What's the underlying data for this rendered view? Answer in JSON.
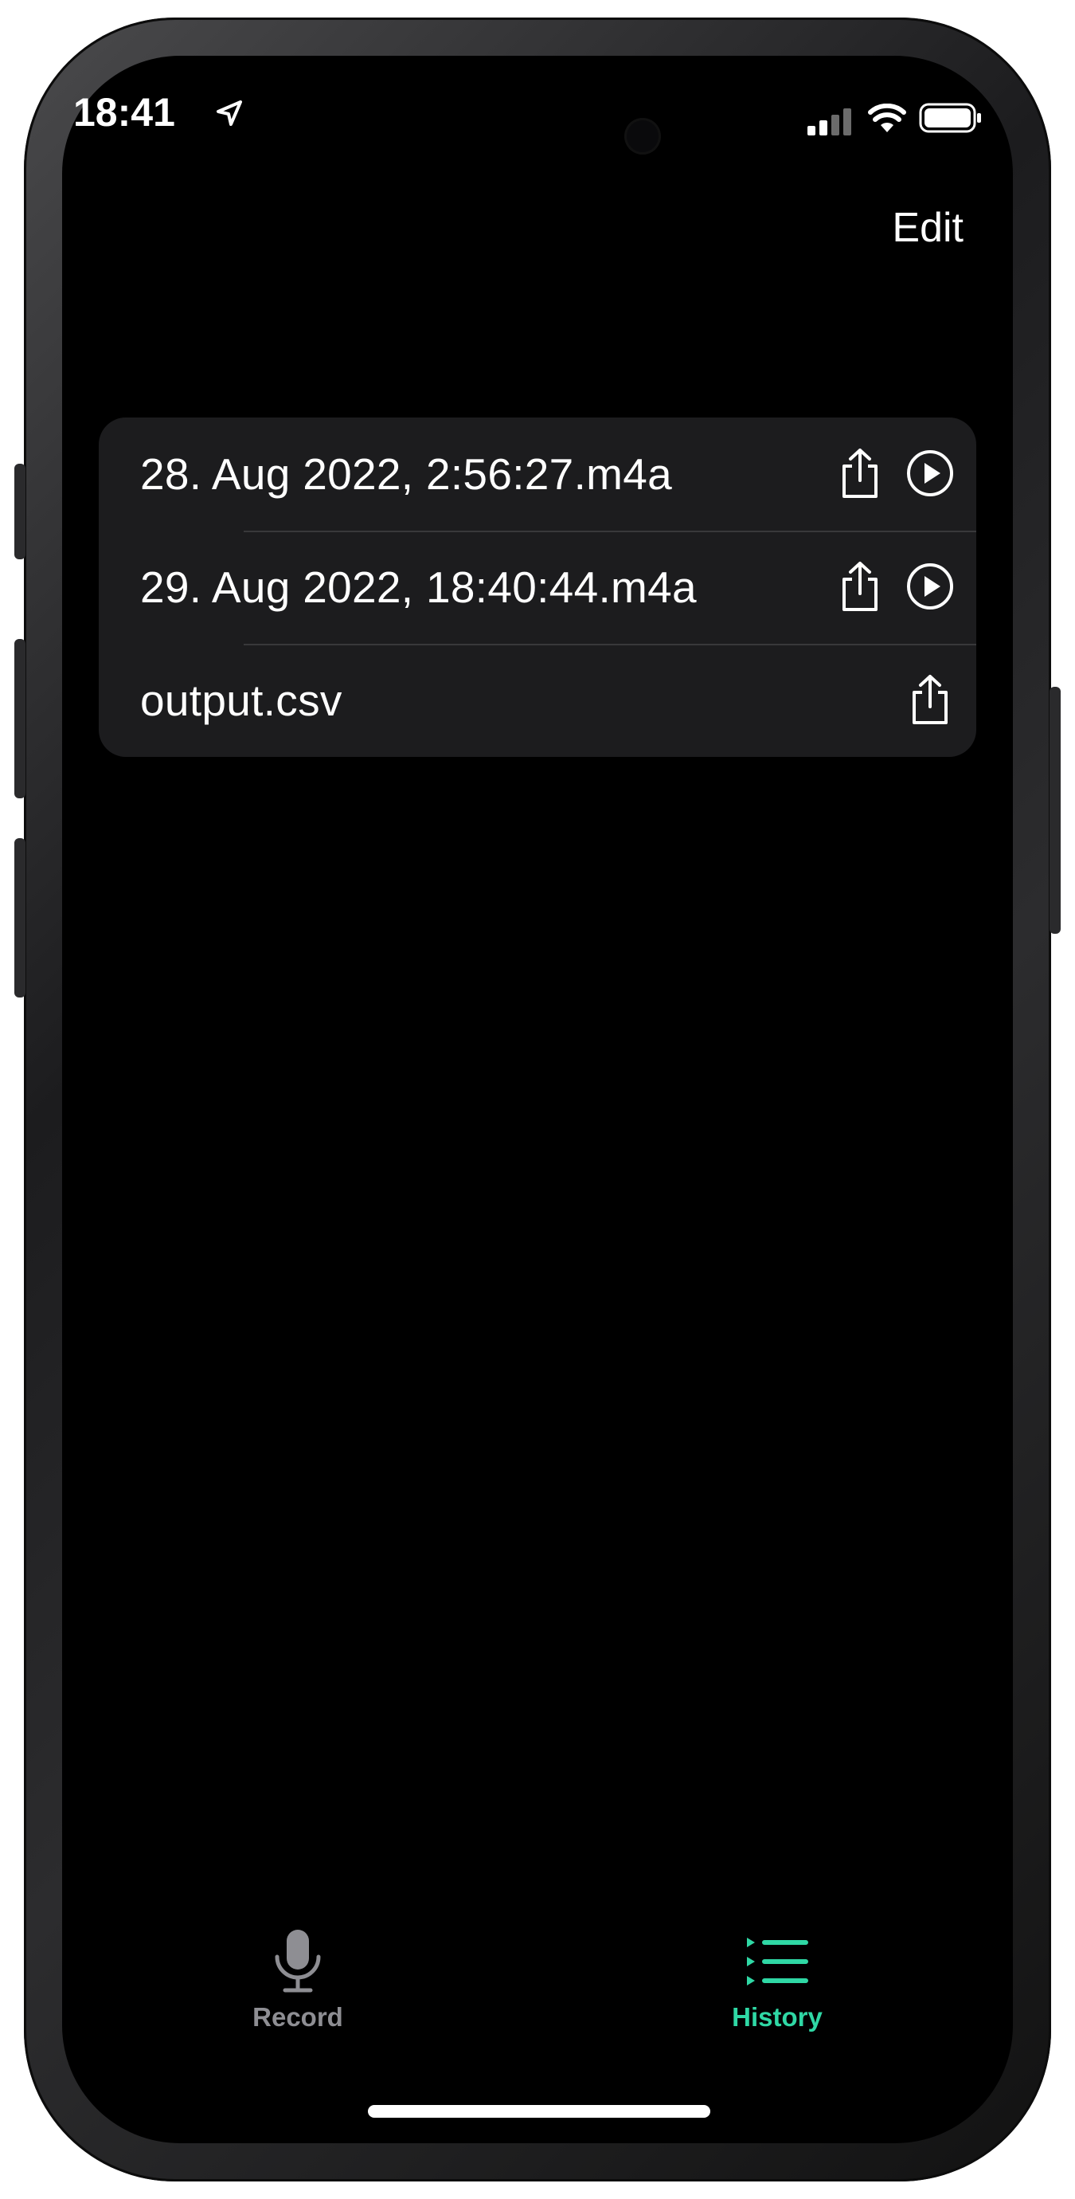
{
  "status_bar": {
    "time": "18:41"
  },
  "nav": {
    "edit_label": "Edit"
  },
  "files": [
    {
      "name": "28. Aug 2022, 2:56:27.m4a",
      "share": true,
      "play": true
    },
    {
      "name": "29. Aug 2022, 18:40:44.m4a",
      "share": true,
      "play": true
    },
    {
      "name": "output.csv",
      "share": true,
      "play": false
    }
  ],
  "tabs": [
    {
      "label": "Record",
      "icon": "microphone-icon",
      "active": false
    },
    {
      "label": "History",
      "icon": "list-icon",
      "active": true
    }
  ],
  "colors": {
    "accent": "#2fd8a5",
    "inactive": "#8e8e93",
    "list_background": "#1c1c1e",
    "separator": "#38383a"
  }
}
